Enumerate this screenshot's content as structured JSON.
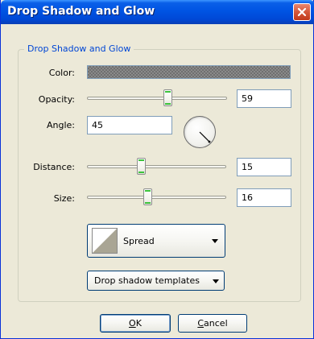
{
  "dialog": {
    "title": "Drop Shadow and Glow",
    "group_label": "Drop Shadow and Glow"
  },
  "fields": {
    "color_label": "Color:",
    "opacity_label": "Opacity:",
    "opacity_value": "59",
    "opacity_fraction": 0.59,
    "angle_label": "Angle:",
    "angle_value": "45",
    "distance_label": "Distance:",
    "distance_value": "15",
    "size_label": "Size:",
    "size_value": "16"
  },
  "buttons": {
    "spread_label": "Spread",
    "templates_label": "Drop shadow templates",
    "ok_accel": "O",
    "ok_rest": "K",
    "cancel_accel": "C",
    "cancel_rest": "ancel"
  },
  "icons": {
    "close": "close-icon",
    "dial": "angle-dial-icon",
    "spread": "spread-preview-icon",
    "dropdown": "chevron-down-icon"
  },
  "colors": {
    "title_bar": "#0054e3",
    "group_label": "#0046d5",
    "close_button": "#d4573a",
    "thumb_accent": "#3cc33c"
  }
}
